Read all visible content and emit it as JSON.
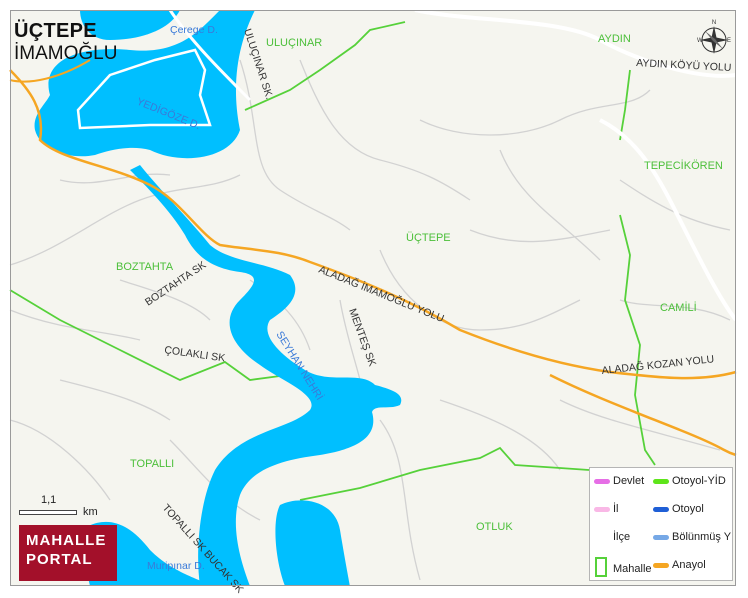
{
  "header": {
    "title": "ÜÇTEPE",
    "subtitle": "İMAMOĞLU"
  },
  "colors": {
    "water": "#00bfff",
    "road_minor": "#d0d0d0",
    "anayol": "#f5a623",
    "mahalle_border": "#56d13a",
    "background": "#f5f5ef",
    "logo_bg": "#a3102a"
  },
  "labels": {
    "cerege": "Çerege D.",
    "ulucinar": "ULUÇINAR",
    "ulucinar_sk": "ULUÇINAR SK.",
    "aydin": "AYDIN",
    "aydin_koyu": "AYDIN KÖYÜ YOLU",
    "yedigoze": "YEDİGÖZE D.",
    "tepecikoren": "TEPECİKÖREN",
    "uctepe": "ÜÇTEPE",
    "boztahta": "BOZTAHTA",
    "boztahta_sk": "BOZTAHTA SK",
    "aladag_imamoglu": "ALADAĞ İMAMOĞLU YOLU",
    "camili": "CAMİLİ",
    "mentes_sk": "MENTEŞ SK",
    "seyhan": "SEYHAN NEHRİ",
    "colakli_sk": "ÇOLAKLI SK",
    "aladag_kozan": "ALADAĞ KOZAN YOLU",
    "topalli": "TOPALLI",
    "otluk": "OTLUK",
    "topalli_sk": "TOPALLI SK BUCAK SK",
    "muripinar": "Muripınar D."
  },
  "scale": {
    "value": "1,1",
    "unit": "km"
  },
  "logo": {
    "line1": "MAHALLE",
    "line2": "PORTAL"
  },
  "compass": {
    "n": "N",
    "s": "S",
    "e": "E",
    "w": "W"
  },
  "legend": {
    "items": [
      {
        "label": "Devlet",
        "color": "#e66ee6",
        "kind": "line"
      },
      {
        "label": "Otoyol-YİD",
        "color": "#5ee51a",
        "kind": "line"
      },
      {
        "label": "İl",
        "color": "#f9b8e6",
        "kind": "line"
      },
      {
        "label": "Otoyol",
        "color": "#1f5fd6",
        "kind": "line"
      },
      {
        "label": "İlçe",
        "color": "",
        "kind": "none"
      },
      {
        "label": "Bölünmüş Y",
        "color": "#76a8e6",
        "kind": "line"
      },
      {
        "label": "Mahalle",
        "color": "#56d13a",
        "kind": "box"
      },
      {
        "label": "Anayol",
        "color": "#f5a623",
        "kind": "line"
      }
    ]
  }
}
